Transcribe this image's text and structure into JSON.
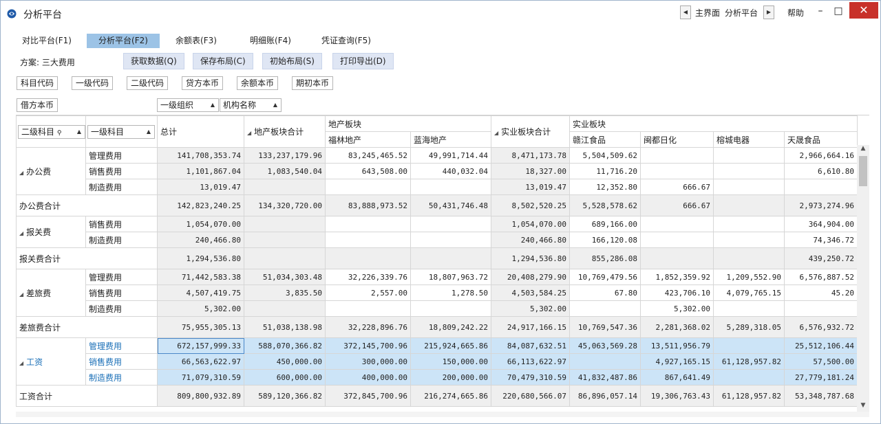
{
  "window": {
    "title": "分析平台"
  },
  "nav": {
    "main": "主界面",
    "current": "分析平台",
    "prev": "◀",
    "next": "▶"
  },
  "window_controls": {
    "help": "帮助",
    "minimize": "–",
    "maximize": "□",
    "close": "✕"
  },
  "tabs": [
    {
      "label": "对比平台(F1)"
    },
    {
      "label": "分析平台(F2)",
      "active": true
    },
    {
      "label": "余额表(F3)"
    },
    {
      "label": "明细账(F4)"
    },
    {
      "label": "凭证查询(F5)"
    }
  ],
  "toolbar": {
    "scheme": "方案: 三大费用",
    "buttons": [
      "获取数据(Q)",
      "保存布局(C)",
      "初始布局(S)",
      "打印导出(D)"
    ]
  },
  "fields_row1": [
    "科目代码",
    "一级代码",
    "二级代码",
    "贷方本币",
    "余额本币",
    "期初本币"
  ],
  "fields_row2": [
    "借方本币"
  ],
  "column_dropdowns": [
    "一级组织",
    "机构名称"
  ],
  "row_dropdowns": [
    "二级科目",
    "一级科目"
  ],
  "table": {
    "header": {
      "total": "总计",
      "group1_sum": "地产板块合计",
      "group1": "地产板块",
      "group1_cols": [
        "福林地产",
        "蓝海地产"
      ],
      "group2_sum": "实业板块合计",
      "group2": "实业板块",
      "group2_cols": [
        "赣江食品",
        "闽都日化",
        "榕城电器",
        "天晟食品"
      ]
    },
    "groups": [
      {
        "name": "办公费",
        "rows": [
          {
            "sub": "管理费用",
            "v": [
              "141,708,353.74",
              "133,237,179.96",
              "83,245,465.52",
              "49,991,714.44",
              "8,471,173.78",
              "5,504,509.62",
              "",
              "",
              "2,966,664.16"
            ]
          },
          {
            "sub": "销售费用",
            "v": [
              "1,101,867.04",
              "1,083,540.04",
              "643,508.00",
              "440,032.04",
              "18,327.00",
              "11,716.20",
              "",
              "",
              "6,610.80"
            ]
          },
          {
            "sub": "制造费用",
            "v": [
              "13,019.47",
              "",
              "",
              "",
              "13,019.47",
              "12,352.80",
              "666.67",
              "",
              ""
            ]
          }
        ],
        "total_label": "办公费合计",
        "total": [
          "142,823,240.25",
          "134,320,720.00",
          "83,888,973.52",
          "50,431,746.48",
          "8,502,520.25",
          "5,528,578.62",
          "666.67",
          "",
          "2,973,274.96"
        ]
      },
      {
        "name": "报关费",
        "rows": [
          {
            "sub": "销售费用",
            "v": [
              "1,054,070.00",
              "",
              "",
              "",
              "1,054,070.00",
              "689,166.00",
              "",
              "",
              "364,904.00"
            ]
          },
          {
            "sub": "制造费用",
            "v": [
              "240,466.80",
              "",
              "",
              "",
              "240,466.80",
              "166,120.08",
              "",
              "",
              "74,346.72"
            ]
          }
        ],
        "total_label": "报关费合计",
        "total": [
          "1,294,536.80",
          "",
          "",
          "",
          "1,294,536.80",
          "855,286.08",
          "",
          "",
          "439,250.72"
        ]
      },
      {
        "name": "差旅费",
        "rows": [
          {
            "sub": "管理费用",
            "v": [
              "71,442,583.38",
              "51,034,303.48",
              "32,226,339.76",
              "18,807,963.72",
              "20,408,279.90",
              "10,769,479.56",
              "1,852,359.92",
              "1,209,552.90",
              "6,576,887.52"
            ]
          },
          {
            "sub": "销售费用",
            "v": [
              "4,507,419.75",
              "3,835.50",
              "2,557.00",
              "1,278.50",
              "4,503,584.25",
              "67.80",
              "423,706.10",
              "4,079,765.15",
              "45.20"
            ]
          },
          {
            "sub": "制造费用",
            "v": [
              "5,302.00",
              "",
              "",
              "",
              "5,302.00",
              "",
              "5,302.00",
              "",
              ""
            ]
          }
        ],
        "total_label": "差旅费合计",
        "total": [
          "75,955,305.13",
          "51,038,138.98",
          "32,228,896.76",
          "18,809,242.22",
          "24,917,166.15",
          "10,769,547.36",
          "2,281,368.02",
          "5,289,318.05",
          "6,576,932.72"
        ]
      },
      {
        "name": "工资",
        "selected": true,
        "rows": [
          {
            "sub": "管理费用",
            "v": [
              "672,157,999.33",
              "588,070,366.82",
              "372,145,700.96",
              "215,924,665.86",
              "84,087,632.51",
              "45,063,569.28",
              "13,511,956.79",
              "",
              "25,512,106.44"
            ]
          },
          {
            "sub": "销售费用",
            "v": [
              "66,563,622.97",
              "450,000.00",
              "300,000.00",
              "150,000.00",
              "66,113,622.97",
              "",
              "4,927,165.15",
              "61,128,957.82",
              "57,500.00"
            ]
          },
          {
            "sub": "制造费用",
            "v": [
              "71,079,310.59",
              "600,000.00",
              "400,000.00",
              "200,000.00",
              "70,479,310.59",
              "41,832,487.86",
              "867,641.49",
              "",
              "27,779,181.24"
            ]
          }
        ],
        "total_label": "工资合计",
        "total": [
          "809,800,932.89",
          "589,120,366.82",
          "372,845,700.96",
          "216,274,665.86",
          "220,680,566.07",
          "86,896,057.14",
          "19,306,763.43",
          "61,128,957.82",
          "53,348,787.68"
        ]
      }
    ]
  }
}
